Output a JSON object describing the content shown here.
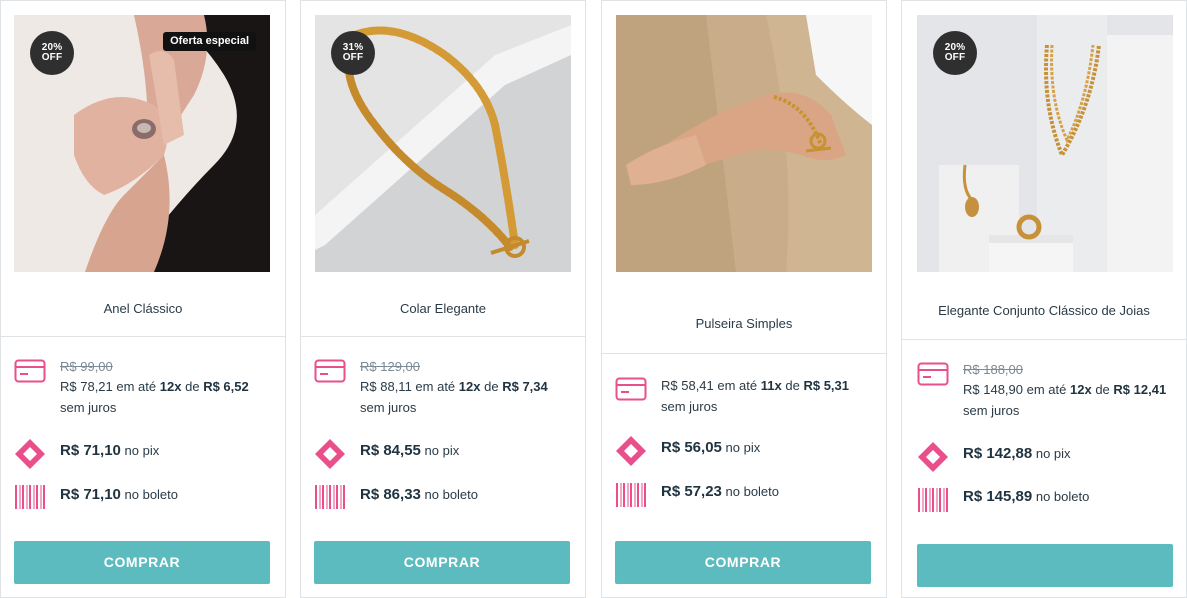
{
  "products": [
    {
      "name": "Anel Clássico",
      "discount": "20%\nOFF",
      "discount_l1": "20%",
      "discount_l2": "OFF",
      "special_badge": "Oferta especial",
      "old_price": "R$ 99,00",
      "installment_price": "R$ 78,21",
      "installment_mid": "em até",
      "installments": "12x",
      "installment_de": "de",
      "installment_value": "R$ 6,52",
      "no_interest": "sem juros",
      "pix_price": "R$ 71,10",
      "pix_label": "no pix",
      "boleto_price": "R$ 71,10",
      "boleto_label": "no boleto",
      "button": "COMPRAR"
    },
    {
      "name": "Colar Elegante",
      "discount_l1": "31%",
      "discount_l2": "OFF",
      "old_price": "R$ 129,00",
      "installment_price": "R$ 88,11",
      "installment_mid": "em até",
      "installments": "12x",
      "installment_de": "de",
      "installment_value": "R$ 7,34",
      "no_interest": "sem juros",
      "pix_price": "R$ 84,55",
      "pix_label": "no pix",
      "boleto_price": "R$ 86,33",
      "boleto_label": "no boleto",
      "button": "COMPRAR"
    },
    {
      "name": "Pulseira Simples",
      "installment_price": "R$ 58,41",
      "installment_mid": "em até",
      "installments": "11x",
      "installment_de": "de",
      "installment_value": "R$ 5,31",
      "no_interest": "sem juros",
      "pix_price": "R$ 56,05",
      "pix_label": "no pix",
      "boleto_price": "R$ 57,23",
      "boleto_label": "no boleto",
      "button": "COMPRAR"
    },
    {
      "name": "Elegante Conjunto Clássico de Joias",
      "discount_l1": "20%",
      "discount_l2": "OFF",
      "old_price": "R$ 188,00",
      "installment_price": "R$ 148,90",
      "installment_mid": "em até",
      "installments": "12x",
      "installment_de": "de",
      "installment_value": "R$ 12,41",
      "no_interest": "sem juros",
      "pix_price": "R$ 142,88",
      "pix_label": "no pix",
      "boleto_price": "R$ 145,89",
      "boleto_label": "no boleto",
      "button": ""
    }
  ],
  "icons": {
    "card": "credit-card-icon",
    "pix": "pix-icon",
    "boleto": "barcode-icon"
  },
  "colors": {
    "accent_pink": "#e94f8a",
    "button_teal": "#5cbbbf",
    "badge_dark": "#2f2f2f"
  }
}
